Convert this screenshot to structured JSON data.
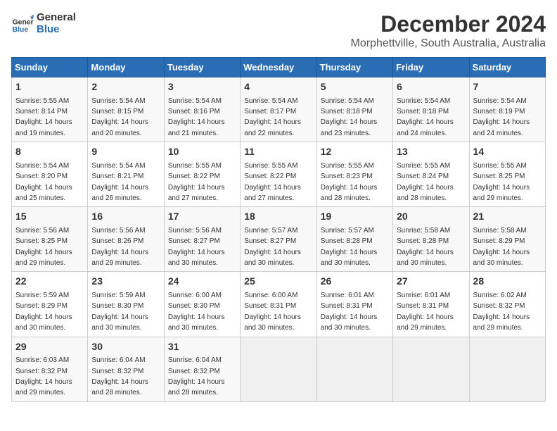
{
  "logo": {
    "line1": "General",
    "line2": "Blue"
  },
  "title": "December 2024",
  "subtitle": "Morphettville, South Australia, Australia",
  "days_of_week": [
    "Sunday",
    "Monday",
    "Tuesday",
    "Wednesday",
    "Thursday",
    "Friday",
    "Saturday"
  ],
  "weeks": [
    [
      {
        "day": "1",
        "sunrise": "5:55 AM",
        "sunset": "8:14 PM",
        "daylight": "14 hours and 19 minutes."
      },
      {
        "day": "2",
        "sunrise": "5:54 AM",
        "sunset": "8:15 PM",
        "daylight": "14 hours and 20 minutes."
      },
      {
        "day": "3",
        "sunrise": "5:54 AM",
        "sunset": "8:16 PM",
        "daylight": "14 hours and 21 minutes."
      },
      {
        "day": "4",
        "sunrise": "5:54 AM",
        "sunset": "8:17 PM",
        "daylight": "14 hours and 22 minutes."
      },
      {
        "day": "5",
        "sunrise": "5:54 AM",
        "sunset": "8:18 PM",
        "daylight": "14 hours and 23 minutes."
      },
      {
        "day": "6",
        "sunrise": "5:54 AM",
        "sunset": "8:18 PM",
        "daylight": "14 hours and 24 minutes."
      },
      {
        "day": "7",
        "sunrise": "5:54 AM",
        "sunset": "8:19 PM",
        "daylight": "14 hours and 24 minutes."
      }
    ],
    [
      {
        "day": "8",
        "sunrise": "5:54 AM",
        "sunset": "8:20 PM",
        "daylight": "14 hours and 25 minutes."
      },
      {
        "day": "9",
        "sunrise": "5:54 AM",
        "sunset": "8:21 PM",
        "daylight": "14 hours and 26 minutes."
      },
      {
        "day": "10",
        "sunrise": "5:55 AM",
        "sunset": "8:22 PM",
        "daylight": "14 hours and 27 minutes."
      },
      {
        "day": "11",
        "sunrise": "5:55 AM",
        "sunset": "8:22 PM",
        "daylight": "14 hours and 27 minutes."
      },
      {
        "day": "12",
        "sunrise": "5:55 AM",
        "sunset": "8:23 PM",
        "daylight": "14 hours and 28 minutes."
      },
      {
        "day": "13",
        "sunrise": "5:55 AM",
        "sunset": "8:24 PM",
        "daylight": "14 hours and 28 minutes."
      },
      {
        "day": "14",
        "sunrise": "5:55 AM",
        "sunset": "8:25 PM",
        "daylight": "14 hours and 29 minutes."
      }
    ],
    [
      {
        "day": "15",
        "sunrise": "5:56 AM",
        "sunset": "8:25 PM",
        "daylight": "14 hours and 29 minutes."
      },
      {
        "day": "16",
        "sunrise": "5:56 AM",
        "sunset": "8:26 PM",
        "daylight": "14 hours and 29 minutes."
      },
      {
        "day": "17",
        "sunrise": "5:56 AM",
        "sunset": "8:27 PM",
        "daylight": "14 hours and 30 minutes."
      },
      {
        "day": "18",
        "sunrise": "5:57 AM",
        "sunset": "8:27 PM",
        "daylight": "14 hours and 30 minutes."
      },
      {
        "day": "19",
        "sunrise": "5:57 AM",
        "sunset": "8:28 PM",
        "daylight": "14 hours and 30 minutes."
      },
      {
        "day": "20",
        "sunrise": "5:58 AM",
        "sunset": "8:28 PM",
        "daylight": "14 hours and 30 minutes."
      },
      {
        "day": "21",
        "sunrise": "5:58 AM",
        "sunset": "8:29 PM",
        "daylight": "14 hours and 30 minutes."
      }
    ],
    [
      {
        "day": "22",
        "sunrise": "5:59 AM",
        "sunset": "8:29 PM",
        "daylight": "14 hours and 30 minutes."
      },
      {
        "day": "23",
        "sunrise": "5:59 AM",
        "sunset": "8:30 PM",
        "daylight": "14 hours and 30 minutes."
      },
      {
        "day": "24",
        "sunrise": "6:00 AM",
        "sunset": "8:30 PM",
        "daylight": "14 hours and 30 minutes."
      },
      {
        "day": "25",
        "sunrise": "6:00 AM",
        "sunset": "8:31 PM",
        "daylight": "14 hours and 30 minutes."
      },
      {
        "day": "26",
        "sunrise": "6:01 AM",
        "sunset": "8:31 PM",
        "daylight": "14 hours and 30 minutes."
      },
      {
        "day": "27",
        "sunrise": "6:01 AM",
        "sunset": "8:31 PM",
        "daylight": "14 hours and 29 minutes."
      },
      {
        "day": "28",
        "sunrise": "6:02 AM",
        "sunset": "8:32 PM",
        "daylight": "14 hours and 29 minutes."
      }
    ],
    [
      {
        "day": "29",
        "sunrise": "6:03 AM",
        "sunset": "8:32 PM",
        "daylight": "14 hours and 29 minutes."
      },
      {
        "day": "30",
        "sunrise": "6:04 AM",
        "sunset": "8:32 PM",
        "daylight": "14 hours and 28 minutes."
      },
      {
        "day": "31",
        "sunrise": "6:04 AM",
        "sunset": "8:32 PM",
        "daylight": "14 hours and 28 minutes."
      },
      null,
      null,
      null,
      null
    ]
  ]
}
